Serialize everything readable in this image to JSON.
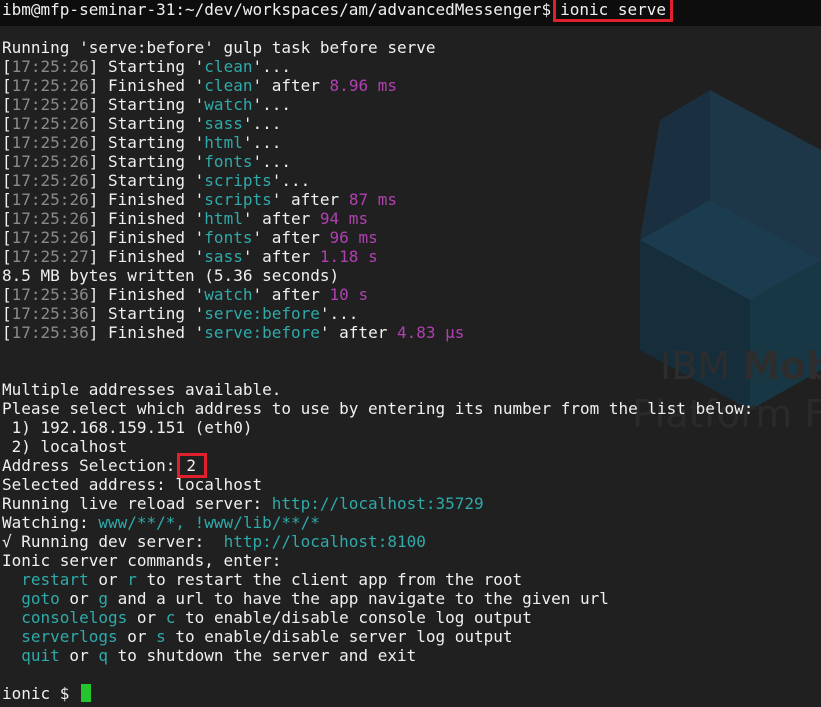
{
  "terminal": {
    "prompt_path": "ibm@mfp-seminar-31:~/dev/workspaces/am/advancedMessenger$",
    "command": "ionic serve",
    "serve_before": "Running 'serve:before' gulp task before serve",
    "tasks": [
      {
        "time": "17:25:26",
        "verb": "Starting",
        "name": "clean",
        "suffix": "..."
      },
      {
        "time": "17:25:26",
        "verb": "Finished",
        "name": "clean",
        "after": " after ",
        "duration": "8.96 ms"
      },
      {
        "time": "17:25:26",
        "verb": "Starting",
        "name": "watch",
        "suffix": "..."
      },
      {
        "time": "17:25:26",
        "verb": "Starting",
        "name": "sass",
        "suffix": "..."
      },
      {
        "time": "17:25:26",
        "verb": "Starting",
        "name": "html",
        "suffix": "..."
      },
      {
        "time": "17:25:26",
        "verb": "Starting",
        "name": "fonts",
        "suffix": "..."
      },
      {
        "time": "17:25:26",
        "verb": "Starting",
        "name": "scripts",
        "suffix": "..."
      },
      {
        "time": "17:25:26",
        "verb": "Finished",
        "name": "scripts",
        "after": " after ",
        "duration": "87 ms"
      },
      {
        "time": "17:25:26",
        "verb": "Finished",
        "name": "html",
        "after": " after ",
        "duration": "94 ms"
      },
      {
        "time": "17:25:26",
        "verb": "Finished",
        "name": "fonts",
        "after": " after ",
        "duration": "96 ms"
      },
      {
        "time": "17:25:27",
        "verb": "Finished",
        "name": "sass",
        "after": " after ",
        "duration": "1.18 s"
      }
    ],
    "bytes_written": "8.5 MB bytes written (5.36 seconds)",
    "tasks2": [
      {
        "time": "17:25:36",
        "verb": "Finished",
        "name": "watch",
        "after": " after ",
        "duration": "10 s"
      },
      {
        "time": "17:25:36",
        "verb": "Starting",
        "name": "serve:before",
        "suffix": "..."
      },
      {
        "time": "17:25:36",
        "verb": "Finished",
        "name": "serve:before",
        "after": " after ",
        "duration": "4.83 μs"
      }
    ],
    "multiple": "Multiple addresses available.",
    "please_select": "Please select which address to use by entering its number from the list below:",
    "option1": " 1) 192.168.159.151 (eth0)",
    "option2": " 2) localhost",
    "address_selection_label": "Address Selection:",
    "address_selection_value": "2",
    "selected_address": "Selected address: localhost",
    "live_reload_label": "Running live reload server: ",
    "live_reload_url": "http://localhost:35729",
    "watching_label": "Watching: ",
    "watching_paths": "www/**/*, !www/lib/**/*",
    "dev_server_label": "√ Running dev server:  ",
    "dev_server_url": "http://localhost:8100",
    "commands_intro": "Ionic server commands, enter:",
    "commands": [
      {
        "cmd": "restart",
        "alias": "r",
        "desc": " to restart the client app from the root"
      },
      {
        "cmd": "goto",
        "alias": "g",
        "desc": " and a url to have the app navigate to the given url"
      },
      {
        "cmd": "consolelogs",
        "alias": "c",
        "desc": " to enable/disable console log output"
      },
      {
        "cmd": "serverlogs",
        "alias": "s",
        "desc": " to enable/disable server log output"
      },
      {
        "cmd": "quit",
        "alias": "q",
        "desc": " to shutdown the server and exit"
      }
    ],
    "or_word": " or ",
    "final_prompt": "ionic $ "
  },
  "wallpaper": {
    "brand_line1_light": "IBM ",
    "brand_line1_bold": "Mob",
    "brand_line2": "Platform Fo"
  },
  "colors": {
    "background": "#202020",
    "task_name": "#2eaaaa",
    "duration": "#b040b0",
    "timestamp": "#8a8a8a",
    "highlight_box": "#e0202a",
    "cursor": "#25c52d"
  }
}
